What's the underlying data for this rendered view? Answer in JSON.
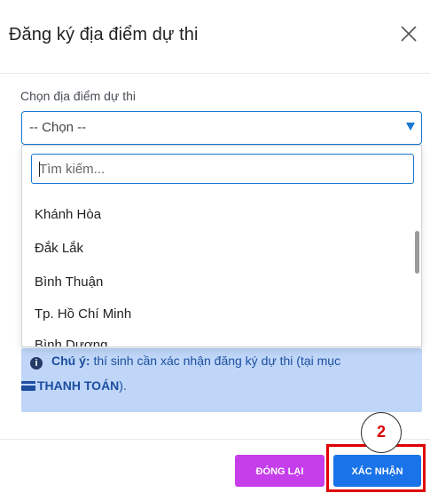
{
  "modal": {
    "title": "Đăng ký địa điểm dự thi",
    "close_icon": "close-icon"
  },
  "form": {
    "label": "Chọn địa điểm dự thi",
    "selected_value": "-- Chọn --"
  },
  "dropdown": {
    "search_placeholder": "Tìm kiếm...",
    "options": [
      {
        "label": "Khánh Hòa"
      },
      {
        "label": "Đắk Lắk"
      },
      {
        "label": "Bình Thuận"
      },
      {
        "label": "Tp. Hồ Chí Minh"
      },
      {
        "label": "Bình Dương"
      }
    ]
  },
  "alert": {
    "note_label": "Chú ý:",
    "note_text": " thí sinh cần xác nhận đăng ký dự thi (tại mục",
    "payment_label": "THANH TOÁN",
    "suffix": ").",
    "icon": "info-icon",
    "background": "#bfd6f8"
  },
  "footer": {
    "close_label": "ĐÓNG LẠI",
    "confirm_label": "XÁC NHẬN"
  },
  "annotation": {
    "step_number": "2",
    "highlight_color": "#e00000"
  },
  "colors": {
    "accent": "#1a73e8",
    "close_button": "#c63dea"
  }
}
